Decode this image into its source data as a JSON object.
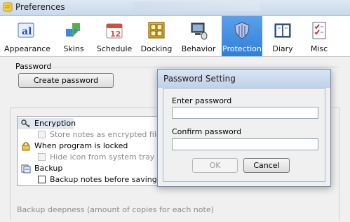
{
  "window": {
    "title": "Preferences"
  },
  "toolbar": {
    "items": [
      {
        "label": "Appearance",
        "icon": "font-a-icon"
      },
      {
        "label": "Skins",
        "icon": "puzzle-icon"
      },
      {
        "label": "Schedule",
        "icon": "calendar-icon"
      },
      {
        "label": "Docking",
        "icon": "docking-grid-icon"
      },
      {
        "label": "Behavior",
        "icon": "computer-mouse-icon"
      },
      {
        "label": "Protection",
        "icon": "shield-icon",
        "active": true
      },
      {
        "label": "Diary",
        "icon": "book-icon"
      },
      {
        "label": "Misc",
        "icon": "checklist-icon"
      }
    ],
    "calendar_day": "12"
  },
  "password_group": {
    "label": "Password",
    "create_button": "Create password"
  },
  "options": {
    "encryption": "Encryption",
    "store_encrypted": "Store notes as encrypted files",
    "when_locked": "When program is locked",
    "hide_icon": "Hide icon from system tray",
    "backup": "Backup",
    "backup_before_saving": "Backup notes before saving"
  },
  "backup_deepness": "Backup deepness (amount of copies for each note)",
  "dialog": {
    "title": "Password Setting",
    "enter_label": "Enter password",
    "enter_value": "",
    "confirm_label": "Confirm password",
    "confirm_value": "",
    "ok": "OK",
    "cancel": "Cancel"
  },
  "colors": {
    "active_tab": "#3a88dc",
    "accent": "#2f7fd7"
  }
}
